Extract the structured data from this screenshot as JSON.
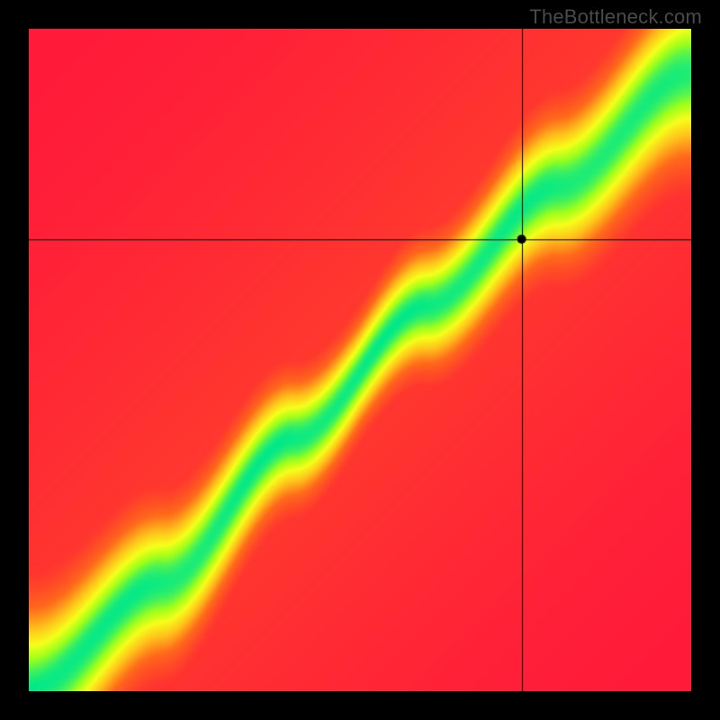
{
  "watermark": "TheBottleneck.com",
  "chart_data": {
    "type": "heatmap",
    "title": "",
    "xlabel": "",
    "ylabel": "",
    "plot_size": 736,
    "outer_size": 800,
    "margin": 32,
    "crosshair": {
      "x_frac": 0.745,
      "y_frac": 0.318
    },
    "marker": {
      "radius": 5,
      "fill": "#000000"
    },
    "colorscale": [
      {
        "t": 0.0,
        "color": "#ff1a3a"
      },
      {
        "t": 0.35,
        "color": "#ff6a1a"
      },
      {
        "t": 0.55,
        "color": "#ffc21a"
      },
      {
        "t": 0.72,
        "color": "#f6ff1a"
      },
      {
        "t": 0.85,
        "color": "#9fff1a"
      },
      {
        "t": 1.0,
        "color": "#00e88a"
      }
    ],
    "ridge": {
      "description": "Green optimal band follows a slightly superlinear diagonal from bottom-left to top-right; crosshair point sits at the lower-right edge of the band.",
      "control_points_xy_frac": [
        [
          0.0,
          1.0
        ],
        [
          0.2,
          0.84
        ],
        [
          0.4,
          0.62
        ],
        [
          0.6,
          0.42
        ],
        [
          0.8,
          0.24
        ],
        [
          1.0,
          0.07
        ]
      ],
      "band_halfwidth_frac": 0.06
    },
    "xlim": [
      0,
      1
    ],
    "ylim": [
      0,
      1
    ]
  }
}
